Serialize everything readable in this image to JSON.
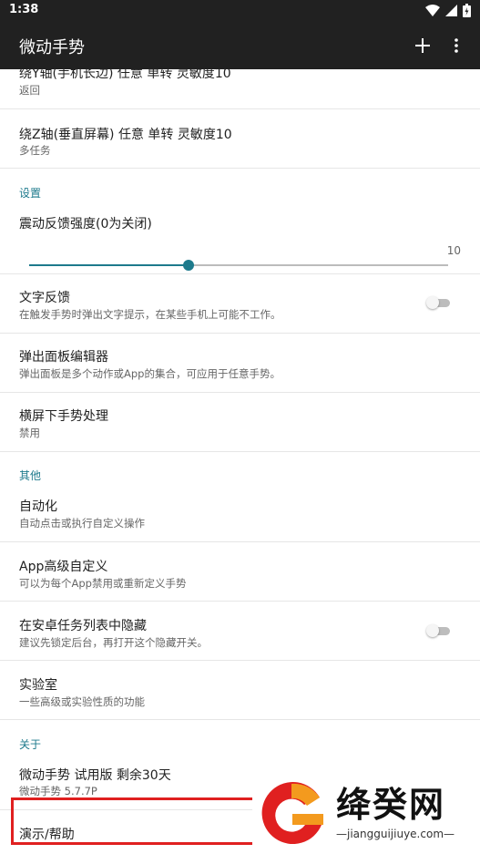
{
  "status_bar": {
    "time": "1:38",
    "icons": [
      "wifi-icon",
      "signal-icon",
      "battery-icon"
    ]
  },
  "app_bar": {
    "title": "微动手势",
    "actions": [
      "add-icon",
      "more-vert-icon"
    ]
  },
  "colors": {
    "accent": "#1d7a8c",
    "toolbar": "#212121",
    "watermark_red": "#e02020",
    "watermark_orange": "#f39a1e"
  },
  "list": {
    "item_y_axis": {
      "title": "绕Y轴(手机长边) 任意 单转 灵敏度10",
      "summary": "返回"
    },
    "item_z_axis": {
      "title": "绕Z轴(垂直屏幕) 任意 单转 灵敏度10",
      "summary": "多任务"
    },
    "category_settings": "设置",
    "vibration": {
      "title": "震动反馈强度(0为关闭)",
      "max_label": "10",
      "value_fraction": 0.38
    },
    "text_feedback": {
      "title": "文字反馈",
      "summary": "在触发手势时弹出文字提示，在某些手机上可能不工作。",
      "checked": false
    },
    "popup_editor": {
      "title": "弹出面板编辑器",
      "summary": "弹出面板是多个动作或App的集合，可应用于任意手势。"
    },
    "landscape": {
      "title": "横屏下手势处理",
      "summary": "禁用"
    },
    "category_other": "其他",
    "automation": {
      "title": "自动化",
      "summary": "自动点击或执行自定义操作"
    },
    "app_customize": {
      "title": "App高级自定义",
      "summary": "可以为每个App禁用或重新定义手势"
    },
    "hide_recents": {
      "title": "在安卓任务列表中隐藏",
      "summary": "建议先锁定后台，再打开这个隐藏开关。",
      "checked": false
    },
    "lab": {
      "title": "实验室",
      "summary": "一些高级或实验性质的功能"
    },
    "category_about": "关于",
    "version": {
      "title": "微动手势 试用版 剩余30天",
      "summary": "微动手势 5.7.7P"
    },
    "help": {
      "title": "演示/帮助"
    }
  },
  "watermark": {
    "title": "绛癸网",
    "url": "—jiangguijiuye.com—"
  }
}
